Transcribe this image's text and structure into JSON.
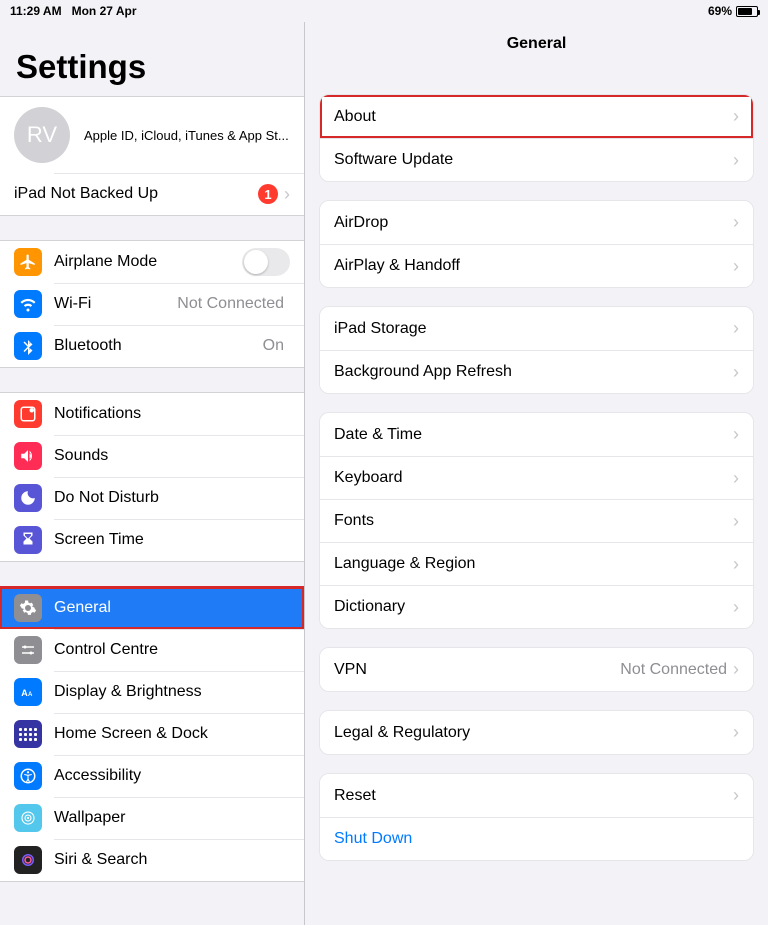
{
  "status": {
    "time": "11:29 AM",
    "date": "Mon 27 Apr",
    "battery": "69%"
  },
  "sidebar": {
    "title": "Settings",
    "apple": {
      "initials": "RV",
      "subtitle": "Apple ID, iCloud, iTunes & App St..."
    },
    "backup": {
      "label": "iPad Not Backed Up",
      "badge": "1"
    },
    "airplane": "Airplane Mode",
    "wifi": {
      "label": "Wi-Fi",
      "value": "Not Connected"
    },
    "bt": {
      "label": "Bluetooth",
      "value": "On"
    },
    "notifications": "Notifications",
    "sounds": "Sounds",
    "dnd": "Do Not Disturb",
    "screentime": "Screen Time",
    "general": "General",
    "controlcentre": "Control Centre",
    "display": "Display & Brightness",
    "homescreen": "Home Screen & Dock",
    "accessibility": "Accessibility",
    "wallpaper": "Wallpaper",
    "siri": "Siri & Search"
  },
  "detail": {
    "title": "General",
    "about": "About",
    "softwareupdate": "Software Update",
    "airdrop": "AirDrop",
    "airplay": "AirPlay & Handoff",
    "storage": "iPad Storage",
    "bgrefresh": "Background App Refresh",
    "datetime": "Date & Time",
    "keyboard": "Keyboard",
    "fonts": "Fonts",
    "language": "Language & Region",
    "dictionary": "Dictionary",
    "vpn": {
      "label": "VPN",
      "value": "Not Connected"
    },
    "legal": "Legal & Regulatory",
    "reset": "Reset",
    "shutdown": "Shut Down"
  }
}
